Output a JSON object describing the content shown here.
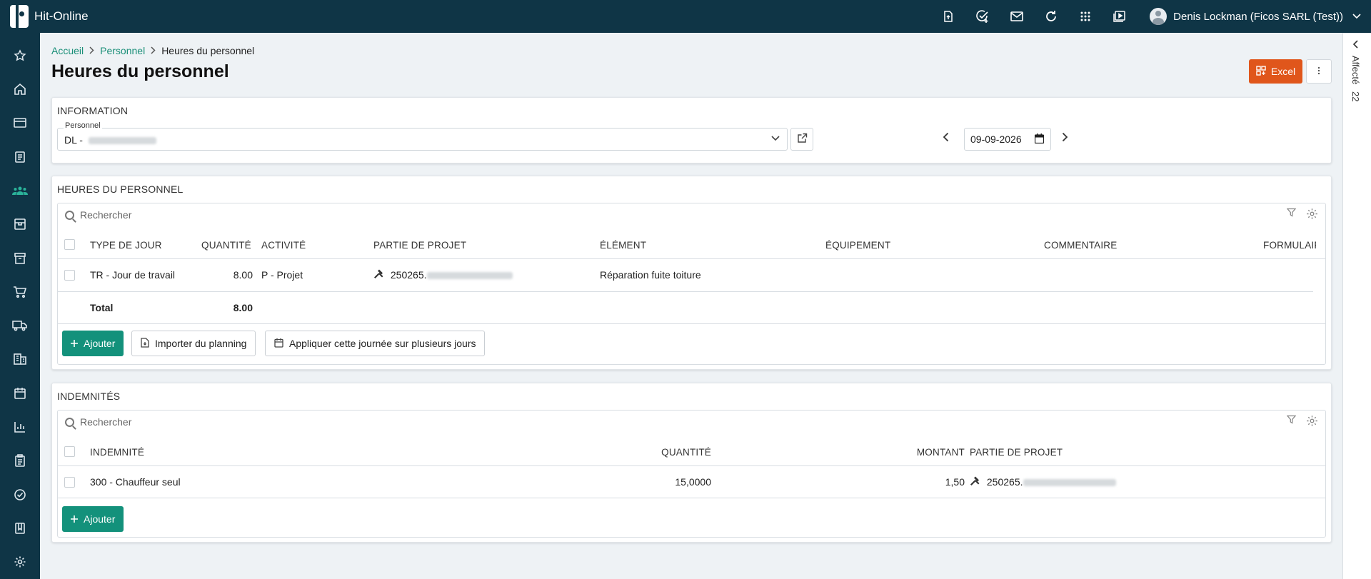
{
  "app": {
    "brand": "Hit-Online",
    "user": "Denis Lockman (Ficos SARL (Test))",
    "top_icons": [
      "upload-file-icon",
      "check-add-icon",
      "mail-icon",
      "refresh-icon",
      "apps-grid-icon",
      "video-icon"
    ]
  },
  "sidebar": {
    "items": [
      "star-icon",
      "home-icon",
      "card-icon",
      "invoice-icon",
      "staff-icon",
      "box-icon",
      "archive-icon",
      "cart-icon",
      "truck-icon",
      "building-icon",
      "calendar-icon",
      "chart-icon",
      "clipboard-icon",
      "check-circle-icon",
      "book-icon",
      "settings-icon"
    ],
    "active": "staff-icon",
    "accent": "#2bb39a"
  },
  "right_panel": {
    "label": "Affecté",
    "count": "22"
  },
  "breadcrumb": {
    "home": "Accueil",
    "parent": "Personnel",
    "current": "Heures du personnel"
  },
  "page": {
    "title": "Heures du personnel"
  },
  "toolbar": {
    "excel_label": "Excel",
    "excel_color": "#e0561b"
  },
  "information": {
    "title": "INFORMATION",
    "personnel_label": "Personnel",
    "personnel_value": "DL -",
    "date": "09-09-2026"
  },
  "hours": {
    "title": "HEURES DU PERSONNEL",
    "search_placeholder": "Rechercher",
    "columns": [
      "TYPE DE JOUR",
      "QUANTITÉ",
      "ACTIVITÉ",
      "PARTIE DE PROJET",
      "ÉLÉMENT",
      "ÉQUIPEMENT",
      "COMMENTAIRE",
      "FORMULAIF"
    ],
    "rows": [
      {
        "type": "TR - Jour de travail",
        "quantity": "8.00",
        "activity": "P - Projet",
        "project": "250265.",
        "element": "Réparation fuite toiture"
      }
    ],
    "total_label": "Total",
    "total_value": "8.00",
    "add_label": "Ajouter",
    "import_label": "Importer du planning",
    "apply_label": "Appliquer cette journée sur plusieurs jours"
  },
  "indemnities": {
    "title": "INDEMNITÉS",
    "search_placeholder": "Rechercher",
    "columns": [
      "INDEMNITÉ",
      "QUANTITÉ",
      "MONTANT",
      "PARTIE DE PROJET"
    ],
    "rows": [
      {
        "indemnity": "300 - Chauffeur seul",
        "quantity": "15,0000",
        "amount": "1,50",
        "project": "250265."
      }
    ],
    "add_label": "Ajouter"
  }
}
